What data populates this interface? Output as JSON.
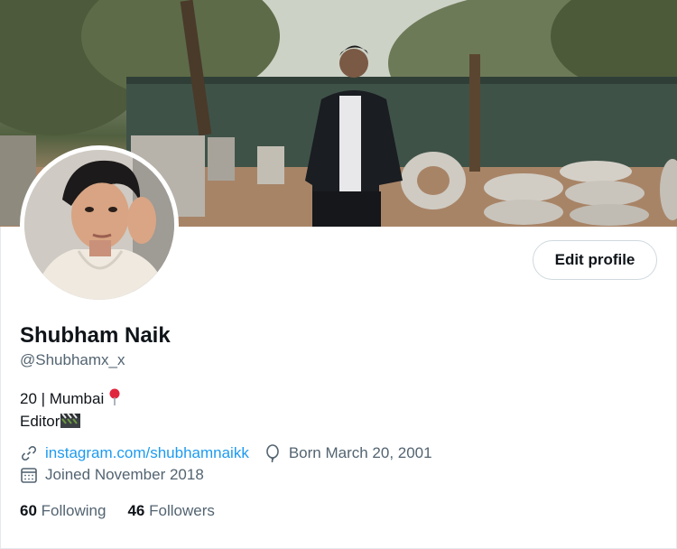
{
  "profile": {
    "name": "Shubham Naik",
    "handle": "@Shubhamx_x",
    "bio_line1": "20 | Mumbai",
    "bio_line1_emoji": "round-pushpin-icon",
    "bio_line2": "Editor",
    "bio_line2_emoji": "clapper-board-icon",
    "website": "instagram.com/shubhamnaikk",
    "birthday": "Born March 20, 2001",
    "joined": "Joined November 2018"
  },
  "actions": {
    "edit_profile_label": "Edit profile"
  },
  "stats": {
    "following_count": "60",
    "following_label": "Following",
    "followers_count": "46",
    "followers_label": "Followers"
  },
  "icons": {
    "website": "link-icon",
    "birthday": "balloon-icon",
    "joined": "calendar-icon"
  },
  "colors": {
    "link": "#1d9bf0",
    "secondary_text": "#536471",
    "primary_text": "#0f1419"
  }
}
